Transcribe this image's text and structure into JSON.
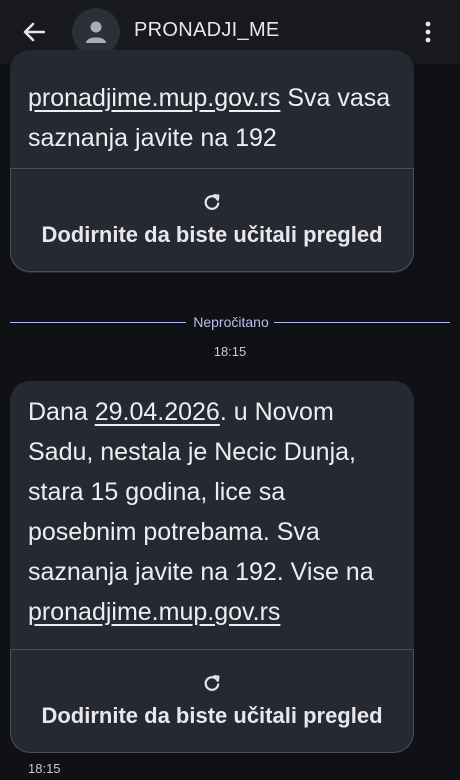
{
  "header": {
    "title": "PRONADJI_ME",
    "back_icon": "arrow-left-icon",
    "avatar_icon": "person-icon",
    "menu_icon": "more-vert-icon"
  },
  "messages": [
    {
      "partial_text_link": "pronadjime.mup.gov.rs",
      "partial_text_rest": " Sva vasa saznanja javite na 192",
      "preview_label": "Dodirnite da biste učitali pregled"
    },
    {
      "text_before_date": "Dana ",
      "date": "29.04.2026",
      "text_after_date": ". u Novom Sadu, nestala je Necic Dunja, stara 15 godina, lice sa posebnim potrebama. Sva saznanja javite na 192. Vise na ",
      "link": "pronadjime.mup.gov.rs",
      "preview_label": "Dodirnite da biste učitali pregled",
      "time": "18:15"
    }
  ],
  "divider": {
    "label": "Nepročitano",
    "time": "18:15"
  },
  "colors": {
    "background": "#0f1115",
    "bubble": "#262931",
    "accent": "#aeb4f0"
  }
}
